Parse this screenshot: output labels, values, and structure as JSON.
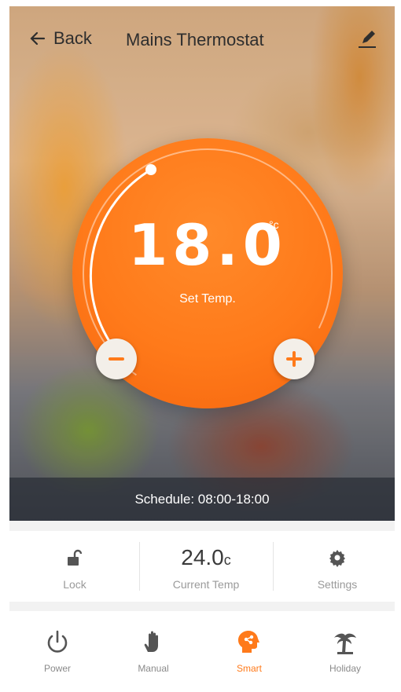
{
  "header": {
    "back_label": "Back",
    "title": "Mains Thermostat"
  },
  "dial": {
    "set_temp": "18.0",
    "unit": "°c",
    "set_label": "Set Temp."
  },
  "schedule": {
    "text": "Schedule: 08:00-18:00"
  },
  "info": {
    "lock_label": "Lock",
    "current_temp_value": "24.0",
    "current_temp_unit": "c",
    "current_temp_label": "Current Temp",
    "settings_label": "Settings"
  },
  "nav": {
    "items": [
      {
        "label": "Power",
        "icon": "power-icon"
      },
      {
        "label": "Manual",
        "icon": "hand-icon"
      },
      {
        "label": "Smart",
        "icon": "smart-brain-icon",
        "active": true
      },
      {
        "label": "Holiday",
        "icon": "palm-tree-icon"
      }
    ]
  },
  "colors": {
    "accent": "#ff7a1a",
    "text_dark": "#2e2e2e",
    "muted": "#9a9a9a"
  }
}
